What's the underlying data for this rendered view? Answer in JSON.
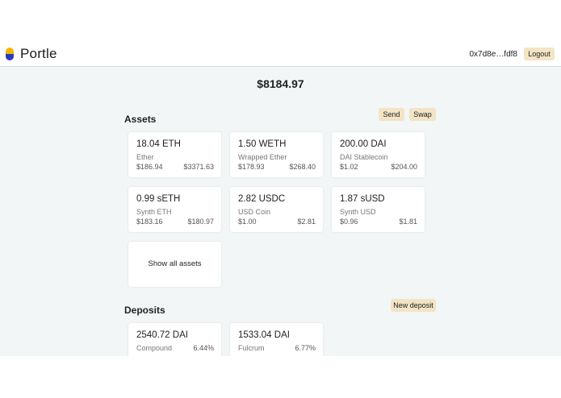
{
  "header": {
    "brand": "Portle",
    "address": "0x7d8e…fdf8",
    "logout_label": "Logout"
  },
  "portfolio": {
    "total": "$8184.97"
  },
  "assets": {
    "title": "Assets",
    "send_label": "Send",
    "swap_label": "Swap",
    "show_all_label": "Show all assets",
    "items": [
      {
        "amount": "18.04 ETH",
        "name": "Ether",
        "price": "$186.94",
        "value": "$3371.63"
      },
      {
        "amount": "1.50 WETH",
        "name": "Wrapped Ether",
        "price": "$178.93",
        "value": "$268.40"
      },
      {
        "amount": "200.00 DAI",
        "name": "DAI Stablecoin",
        "price": "$1.02",
        "value": "$204.00"
      },
      {
        "amount": "0.99 sETH",
        "name": "Synth ETH",
        "price": "$183.16",
        "value": "$180.97"
      },
      {
        "amount": "2.82 USDC",
        "name": "USD Coin",
        "price": "$1.00",
        "value": "$2.81"
      },
      {
        "amount": "1.87 sUSD",
        "name": "Synth USD",
        "price": "$0.96",
        "value": "$1.81"
      }
    ]
  },
  "deposits": {
    "title": "Deposits",
    "new_deposit_label": "New deposit",
    "items": [
      {
        "amount": "2540.72 DAI",
        "platform": "Compound",
        "rate": "6.44%"
      },
      {
        "amount": "1533.04 DAI",
        "platform": "Fulcrum",
        "rate": "6.77%"
      }
    ]
  },
  "colors": {
    "button_bg": "#f2e4c4",
    "logo_yellow": "#f2b705",
    "logo_blue": "#2b3ab8",
    "page_bg": "#f3f6f7"
  }
}
